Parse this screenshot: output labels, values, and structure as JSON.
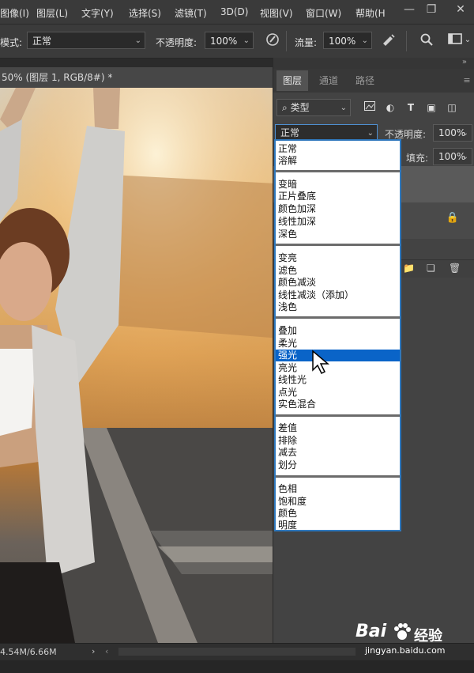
{
  "menubar": {
    "items": [
      "图像(I)",
      "图层(L)",
      "文字(Y)",
      "选择(S)",
      "滤镜(T)",
      "3D(D)",
      "视图(V)",
      "窗口(W)",
      "帮助(H"
    ]
  },
  "options": {
    "mode_label": "模式:",
    "mode_value": "正常",
    "opacity_label": "不透明度:",
    "opacity_value": "100%",
    "flow_label": "流量:",
    "flow_value": "100%"
  },
  "document": {
    "tab_title": "50% (图层 1, RGB/8#) *",
    "status": "4.54M/6.66M"
  },
  "layers_panel": {
    "tabs": [
      "图层",
      "通道",
      "路径"
    ],
    "active_tab": 0,
    "filter_kind": "类型",
    "blend_mode": "正常",
    "opacity_label": "不透明度:",
    "opacity_value": "100%",
    "fill_label": "填充:",
    "fill_value": "100%"
  },
  "blend_modes": {
    "groups": [
      [
        "正常",
        "溶解"
      ],
      [
        "变暗",
        "正片叠底",
        "颜色加深",
        "线性加深",
        "深色"
      ],
      [
        "变亮",
        "滤色",
        "颜色减淡",
        "线性减淡（添加）",
        "浅色"
      ],
      [
        "叠加",
        "柔光",
        "强光",
        "亮光",
        "线性光",
        "点光",
        "实色混合"
      ],
      [
        "差值",
        "排除",
        "减去",
        "划分"
      ],
      [
        "色相",
        "饱和度",
        "颜色",
        "明度"
      ]
    ],
    "selected": "强光"
  },
  "watermark": {
    "brand": "Bai",
    "brand2": "经验",
    "url": "jingyan.baidu.com"
  },
  "colors": {
    "selection_blue": "#0a64c8",
    "dropdown_border": "#2f78bd",
    "chrome_dark": "#3a3a3a"
  }
}
